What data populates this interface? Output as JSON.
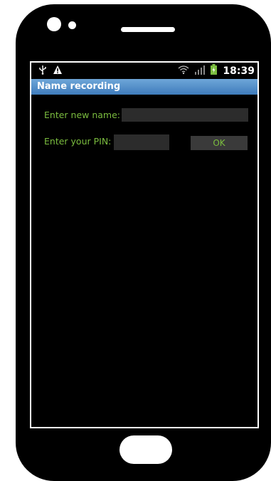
{
  "statusbar": {
    "time": "18:39",
    "icons": [
      "usb-icon",
      "warning-icon",
      "wifi-icon",
      "signal-icon",
      "battery-icon"
    ]
  },
  "app": {
    "title": "Name recording"
  },
  "form": {
    "name_label": "Enter new name:",
    "name_value": "",
    "pin_label": "Enter your PIN:",
    "pin_value": "",
    "ok_label": "OK"
  },
  "colors": {
    "titlebar": "#4a88c6",
    "label_text": "#7bbd3f",
    "field_bg": "#2c2c2c"
  }
}
